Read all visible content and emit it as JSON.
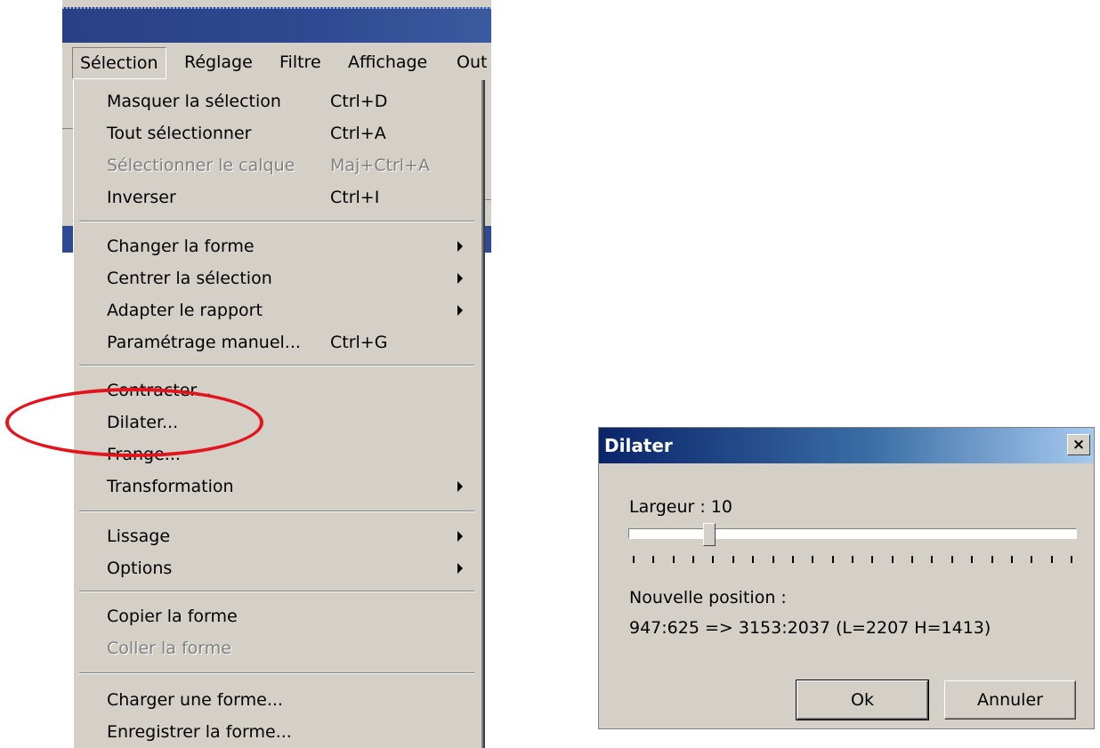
{
  "menubar": {
    "items": [
      "Sélection",
      "Réglage",
      "Filtre",
      "Affichage",
      "Out"
    ]
  },
  "menu": {
    "items": [
      {
        "label": "Masquer la sélection",
        "shortcut": "Ctrl+D"
      },
      {
        "label": "Tout sélectionner",
        "shortcut": "Ctrl+A"
      },
      {
        "label": "Sélectionner le calque",
        "shortcut": "Maj+Ctrl+A",
        "disabled": true
      },
      {
        "label": "Inverser",
        "shortcut": "Ctrl+I"
      },
      {
        "label": "Changer la forme",
        "submenu": true
      },
      {
        "label": "Centrer la sélection",
        "submenu": true
      },
      {
        "label": "Adapter le rapport",
        "submenu": true
      },
      {
        "label": "Paramétrage manuel...",
        "shortcut": "Ctrl+G"
      },
      {
        "label": "Contracter..."
      },
      {
        "label": "Dilater..."
      },
      {
        "label": "Frange..."
      },
      {
        "label": "Transformation",
        "submenu": true
      },
      {
        "label": "Lissage",
        "submenu": true
      },
      {
        "label": "Options",
        "submenu": true
      },
      {
        "label": "Copier la forme"
      },
      {
        "label": "Coller la forme",
        "disabled": true
      },
      {
        "label": "Charger une forme..."
      },
      {
        "label": "Enregistrer la forme..."
      }
    ]
  },
  "dialog": {
    "title": "Dilater",
    "close_glyph": "×",
    "width_label": "Largeur : 10",
    "slider_fraction": 0.18,
    "tick_count": 23,
    "position_label": "Nouvelle position :",
    "position_value": "947:625 => 3153:2037 (L=2207  H=1413)",
    "ok_label": "Ok",
    "cancel_label": "Annuler"
  },
  "colors": {
    "highlight_ellipse": "#e3141b",
    "title_bar": "#0a246a"
  }
}
